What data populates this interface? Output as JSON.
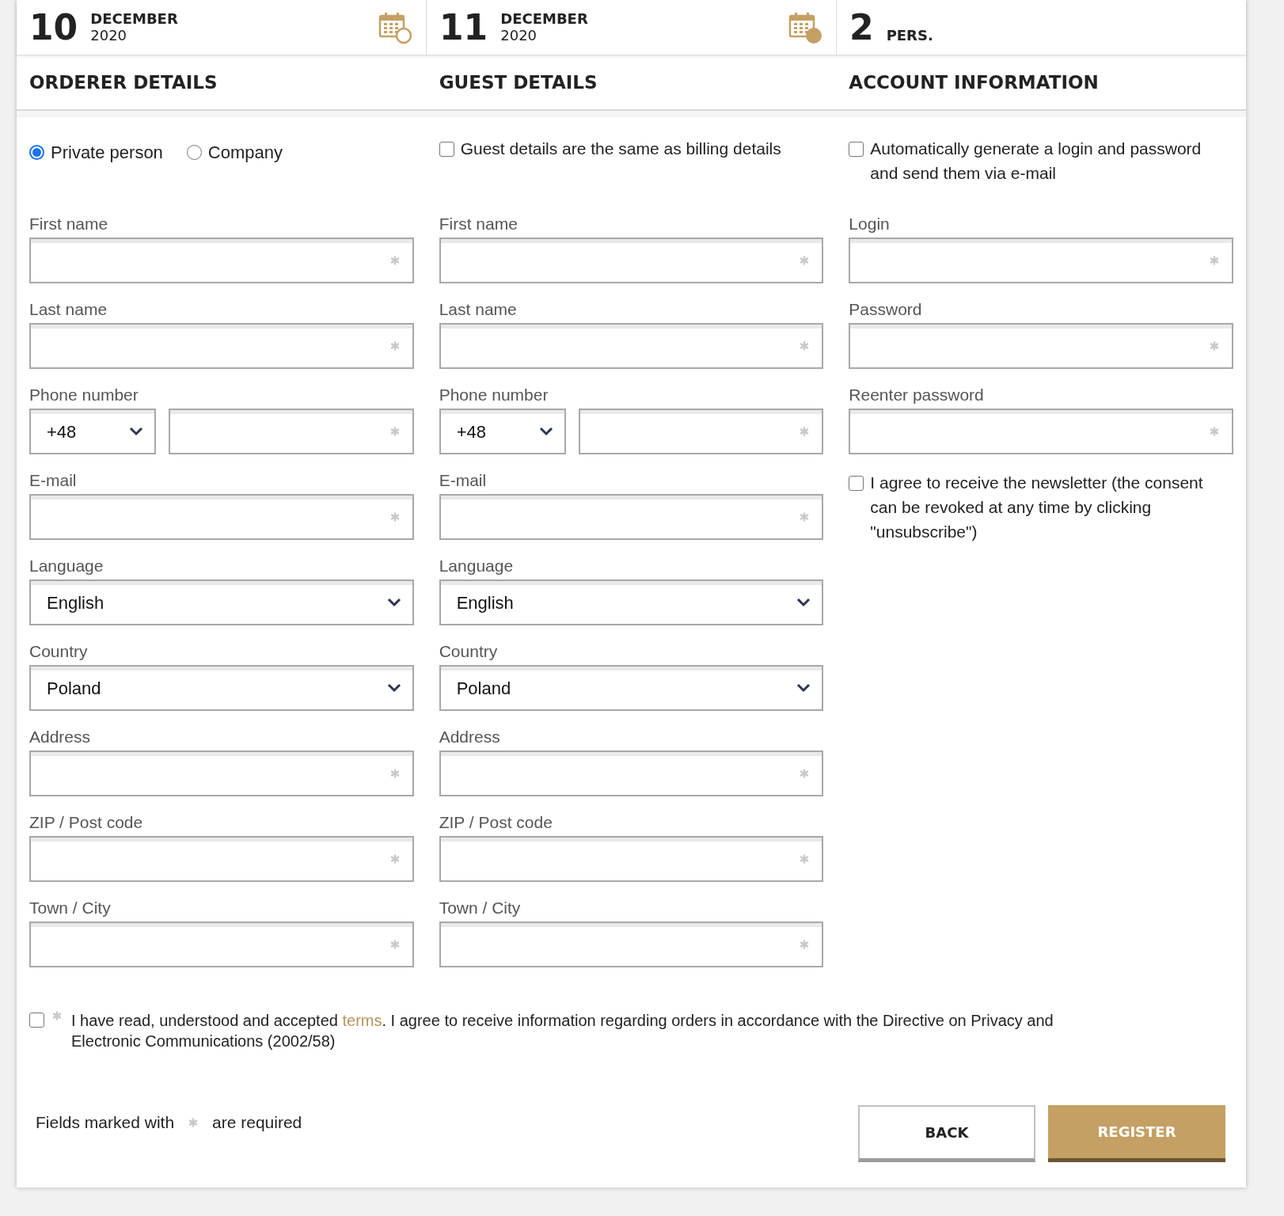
{
  "header": [
    {
      "kind": "check_in",
      "day": "10",
      "month": "DECEMBER",
      "year": "2020"
    },
    {
      "kind": "check_out",
      "day": "11",
      "month": "DECEMBER",
      "year": "2020"
    },
    {
      "kind": "guests",
      "day": "2",
      "month": "PERS."
    }
  ],
  "sections": [
    {
      "title": "ORDERER DETAILS",
      "items": [
        {
          "kind": "radios",
          "options": [
            {
              "label": "Private person",
              "selected": true
            },
            {
              "label": "Company",
              "selected": false
            }
          ]
        },
        {
          "kind": "text",
          "label": "First name",
          "required": true
        },
        {
          "kind": "text",
          "label": "Last name",
          "required": true
        },
        {
          "kind": "phone",
          "label": "Phone number",
          "code": "+48",
          "required": true
        },
        {
          "kind": "text",
          "label": "E-mail",
          "required": true
        },
        {
          "kind": "select",
          "label": "Language",
          "value": "English"
        },
        {
          "kind": "select",
          "label": "Country",
          "value": "Poland"
        },
        {
          "kind": "text",
          "label": "Address",
          "required": true
        },
        {
          "kind": "text",
          "label": "ZIP / Post code",
          "required": true
        },
        {
          "kind": "text",
          "label": "Town / City",
          "required": true
        }
      ]
    },
    {
      "title": "GUEST DETAILS",
      "items": [
        {
          "kind": "checkbox",
          "label": "Guest details are the same as billing details",
          "checked": false
        },
        {
          "kind": "text",
          "label": "First name",
          "required": true
        },
        {
          "kind": "text",
          "label": "Last name",
          "required": true
        },
        {
          "kind": "phone",
          "label": "Phone number",
          "code": "+48",
          "required": true
        },
        {
          "kind": "text",
          "label": "E-mail",
          "required": true
        },
        {
          "kind": "select",
          "label": "Language",
          "value": "English"
        },
        {
          "kind": "select",
          "label": "Country",
          "value": "Poland"
        },
        {
          "kind": "text",
          "label": "Address",
          "required": true
        },
        {
          "kind": "text",
          "label": "ZIP / Post code",
          "required": true
        },
        {
          "kind": "text",
          "label": "Town / City",
          "required": true
        }
      ]
    },
    {
      "title": "ACCOUNT INFORMATION",
      "items": [
        {
          "kind": "checkbox",
          "label": "Automatically generate a login and password and send them via e-mail",
          "checked": false
        },
        {
          "kind": "text",
          "label": "Login",
          "required": true
        },
        {
          "kind": "text",
          "label": "Password",
          "required": true
        },
        {
          "kind": "text",
          "label": "Reenter password",
          "required": true
        },
        {
          "kind": "checkbox",
          "label": "I agree to receive the newsletter (the consent can be revoked at any time by clicking \"unsubscribe\")",
          "checked": false
        }
      ]
    }
  ],
  "terms": {
    "checked": false,
    "required": true,
    "before": "I have read, understood and accepted ",
    "link": "terms",
    "after": ". I agree to receive information regarding orders in accordance with the Directive on Privacy and Electronic Communications (2002/58)"
  },
  "footer": {
    "note_before": "Fields marked with",
    "note_after": "are required"
  },
  "buttons": [
    {
      "label": "BACK",
      "kind": "secondary"
    },
    {
      "label": "REGISTER",
      "kind": "primary"
    }
  ]
}
